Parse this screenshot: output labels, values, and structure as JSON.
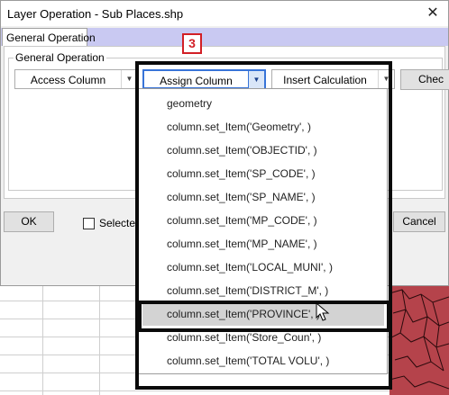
{
  "window": {
    "title": "Layer Operation - Sub Places.shp",
    "close_glyph": "✕"
  },
  "tabs": [
    {
      "label": "General Operation"
    }
  ],
  "group": {
    "label": "General Operation"
  },
  "toolbar": {
    "access_column": "Access Column",
    "assign_column": "Assign Column",
    "insert_calculation": "Insert Calculation",
    "check_truncated": "Chec"
  },
  "buttons": {
    "ok": "OK",
    "cancel": "Cancel",
    "selected_truncated": "Selected"
  },
  "dropdown": {
    "items": [
      {
        "label": "geometry"
      },
      {
        "label": "column.set_Item('Geometry',       )"
      },
      {
        "label": "column.set_Item('OBJECTID',       )"
      },
      {
        "label": "column.set_Item('SP_CODE',        )"
      },
      {
        "label": "column.set_Item('SP_NAME',        )"
      },
      {
        "label": "column.set_Item('MP_CODE',        )"
      },
      {
        "label": "column.set_Item('MP_NAME',        )"
      },
      {
        "label": "column.set_Item('LOCAL_MUNI',       )"
      },
      {
        "label": "column.set_Item('DISTRICT_M',       )"
      },
      {
        "label": "column.set_Item('PROVINCE',        )"
      },
      {
        "label": "column.set_Item('Store_Coun',       )"
      },
      {
        "label": "column.set_Item('TOTAL VOLU',       )"
      }
    ],
    "highlighted_index": 9
  },
  "annotation": {
    "step_number": "3"
  },
  "colors": {
    "highlight": "#d3d3d3",
    "tab_strip": "#c9c9f2",
    "badge": "#d21f26",
    "map": "#b5434b"
  },
  "icons": [
    "close-icon",
    "chevron-down-icon",
    "checkbox-icon",
    "mouse-cursor-icon"
  ]
}
